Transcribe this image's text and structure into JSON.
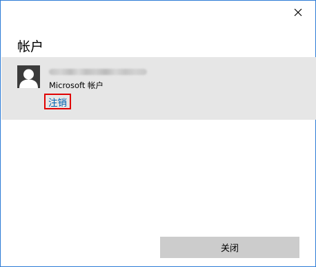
{
  "dialog": {
    "title": "帐户",
    "close_icon": "close-icon"
  },
  "account": {
    "avatar_icon": "user-icon",
    "type_label": "Microsoft 帐户",
    "sign_out_label": "注销",
    "sign_out_highlight_color": "#e00000",
    "link_color": "#0063b1"
  },
  "footer": {
    "close_button_label": "关闭"
  },
  "colors": {
    "panel_background": "#e6e6e6",
    "window_border": "#2b7bd6",
    "button_background": "#cccccc"
  }
}
